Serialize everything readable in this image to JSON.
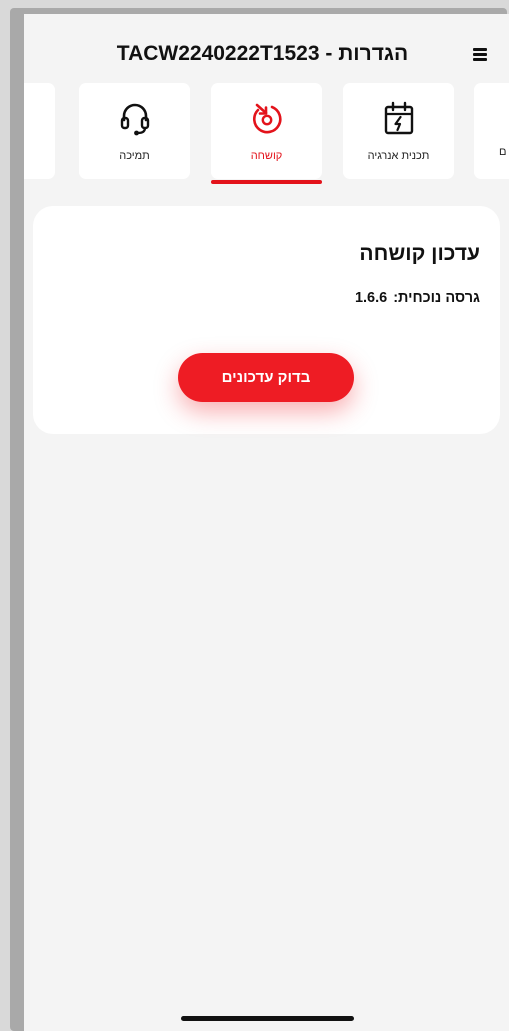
{
  "header": {
    "title": "הגדרות - TACW2240222T1523"
  },
  "tabs": [
    {
      "label": "",
      "icon": "partial-tab"
    },
    {
      "label": "תמיכה",
      "icon": "headset-icon"
    },
    {
      "label": "קושחה",
      "icon": "firmware-update-icon",
      "active": true
    },
    {
      "label": "תכנית אנרגיה",
      "icon": "calendar-energy-icon"
    },
    {
      "label": "ם",
      "icon": "partial-tab"
    }
  ],
  "firmware": {
    "title": "עדכון קושחה",
    "version_label": "גרסה נוכחית:",
    "version_value": "1.6.6",
    "check_button": "בדוק עדכונים"
  },
  "colors": {
    "accent": "#e3131b",
    "background": "#f4f4f4",
    "card": "#ffffff"
  }
}
